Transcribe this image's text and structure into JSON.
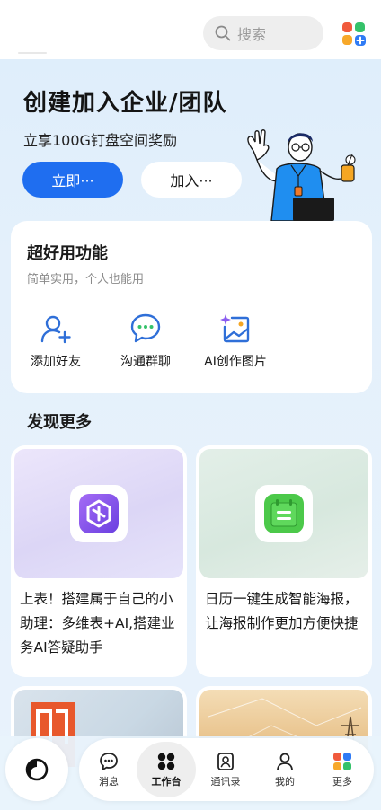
{
  "search": {
    "placeholder": "搜索"
  },
  "hero": {
    "title": "创建加入企业/团队",
    "subtitle": "立享100G钉盘空间奖励",
    "primary_button": "立即···",
    "secondary_button": "加入···"
  },
  "features": {
    "title": "超好用功能",
    "subtitle": "简单实用，个人也能用",
    "items": [
      {
        "label": "添加好友",
        "icon": "add-friend-icon"
      },
      {
        "label": "沟通群聊",
        "icon": "group-chat-icon"
      },
      {
        "label": "AI创作图片",
        "icon": "ai-image-icon"
      }
    ]
  },
  "discover": {
    "title": "发现更多",
    "cards": [
      {
        "text": "上表！搭建属于自己的小助理：多维表+AI,搭建业务AI答疑助手",
        "icon": "multi-table-icon"
      },
      {
        "text": "日历一键生成智能海报，让海报制作更加方便快捷",
        "icon": "calendar-note-icon"
      }
    ]
  },
  "bottom_nav": {
    "items": [
      {
        "label": "消息",
        "icon": "message-icon"
      },
      {
        "label": "工作台",
        "icon": "workbench-icon",
        "active": true
      },
      {
        "label": "通讯录",
        "icon": "contacts-icon"
      },
      {
        "label": "我的",
        "icon": "profile-icon"
      },
      {
        "label": "更多",
        "icon": "more-apps-icon"
      }
    ]
  },
  "colors": {
    "accent": "#1f6ef0",
    "background": "#e4f0fb",
    "card": "#ffffff"
  }
}
